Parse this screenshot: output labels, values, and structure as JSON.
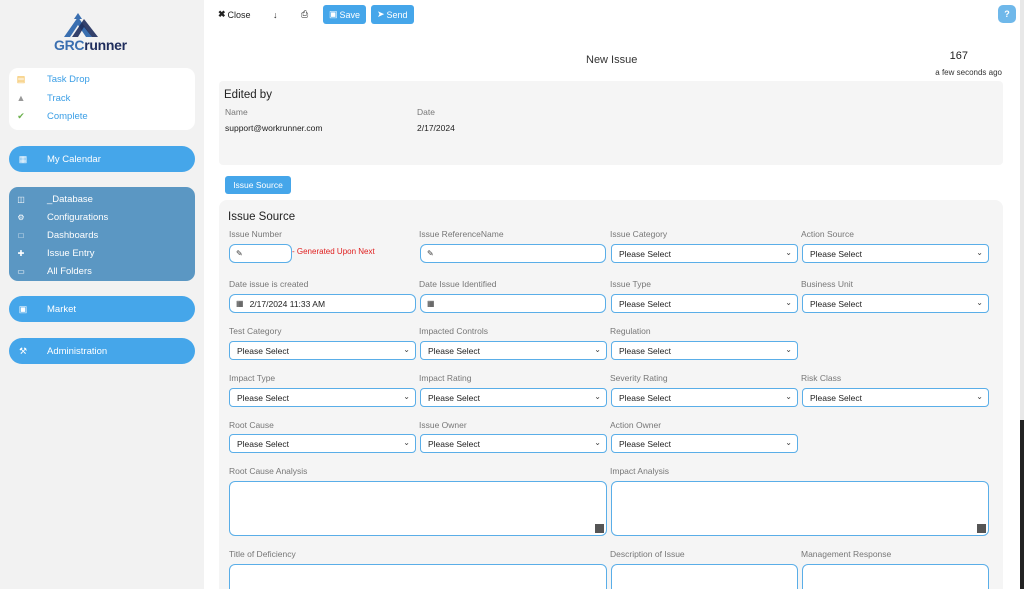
{
  "sidebar": {
    "logo_text_prefix": "GRC",
    "logo_text_suffix": "runner",
    "tasks": [
      {
        "label": "Task Drop",
        "icon": "inbox-icon"
      },
      {
        "label": "Track",
        "icon": "binoculars-icon"
      },
      {
        "label": "Complete",
        "icon": "check-icon"
      }
    ],
    "calendar_label": "My Calendar",
    "database_items": [
      {
        "label": "_Database",
        "icon": "database-icon"
      },
      {
        "label": "Configurations",
        "icon": "cogs-icon"
      },
      {
        "label": "Dashboards",
        "icon": "chart-area-icon"
      },
      {
        "label": "Issue Entry",
        "icon": "crosshair-icon"
      },
      {
        "label": "All Folders",
        "icon": "folder-icon"
      }
    ],
    "market_label": "Market",
    "administration_label": "Administration"
  },
  "toolbar": {
    "close_label": "Close",
    "save_label": "Save",
    "send_label": "Send",
    "help_label": "?"
  },
  "header": {
    "title": "New Issue",
    "issue_id": "167",
    "updated": "a few seconds ago"
  },
  "edited_by": {
    "heading": "Edited by",
    "name_label": "Name",
    "date_label": "Date",
    "name_value": "support@workrunner.com",
    "date_value": "2/17/2024"
  },
  "tab_label": "Issue Source",
  "form": {
    "section_title": "Issue Source",
    "placeholder": "Please Select",
    "generated_note": "- Generated Upon Next",
    "date_created_value": "2/17/2024 11:33 AM",
    "labels": {
      "issue_number": "Issue Number",
      "issue_reference_name": "Issue ReferenceName",
      "issue_category": "Issue Category",
      "action_source": "Action Source",
      "date_created": "Date issue is created",
      "date_identified": "Date Issue Identified",
      "issue_type": "Issue Type",
      "business_unit": "Business Unit",
      "test_category": "Test Category",
      "impacted_controls": "Impacted Controls",
      "regulation": "Regulation",
      "impact_type": "Impact Type",
      "impact_rating": "Impact Rating",
      "severity_rating": "Severity Rating",
      "risk_class": "Risk Class",
      "root_cause": "Root Cause",
      "issue_owner": "Issue Owner",
      "action_owner": "Action Owner",
      "root_cause_analysis": "Root Cause Analysis",
      "impact_analysis": "Impact Analysis",
      "title_of_deficiency": "Title of Deficiency",
      "description_of_issue": "Description of Issue",
      "management_response": "Management Response"
    }
  },
  "colors": {
    "accent": "#45a6ea",
    "database_panel": "#5b97c3",
    "error": "#e02020"
  }
}
